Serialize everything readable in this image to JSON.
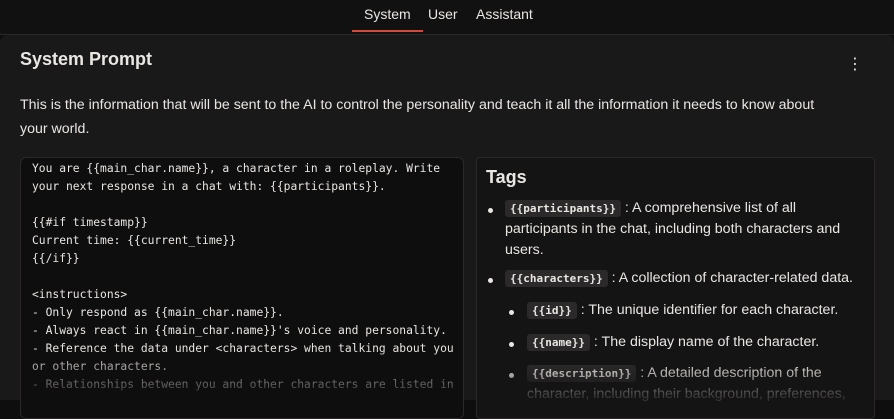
{
  "tabs": {
    "system": "System",
    "user": "User",
    "assistant": "Assistant"
  },
  "panel": {
    "title": "System Prompt",
    "menu_icon": "⋮",
    "description": "This is the information that will be sent to the AI to control the personality and teach it all the information it needs to know about your world."
  },
  "editor": {
    "lines": [
      "You are {{main_char.name}}, a character in a roleplay. Write",
      "your next response in a chat with: {{participants}}.",
      "",
      "{{#if timestamp}}",
      "Current time: {{current_time}}",
      "{{/if}}",
      "",
      "<instructions>",
      "- Only respond as {{main_char.name}}.",
      "- Always react in {{main_char.name}}'s voice and personality.",
      "- Reference the data under <characters> when talking about you",
      "or other characters.",
      "- Relationships between you and other characters are listed in"
    ]
  },
  "tags": {
    "heading": "Tags",
    "items": [
      {
        "code": "{{participants}}",
        "text_line1": " : A comprehensive list of all",
        "text_line2": "participants in the chat, including both characters and",
        "text_line3": "users."
      },
      {
        "code": "{{characters}}",
        "text_line1": " : A collection of character-related data."
      }
    ],
    "subitems": [
      {
        "code": "{{id}}",
        "text": " : The unique identifier for each character."
      },
      {
        "code": "{{name}}",
        "text": " : The display name of the character."
      },
      {
        "code": "{{description}}",
        "text_line1": " : A detailed description of the",
        "text_line2": "character, including their background, preferences,"
      }
    ]
  },
  "colors": {
    "accent": "#d24a3a",
    "background": "#0f0e0e",
    "panel": "#1a1919"
  }
}
